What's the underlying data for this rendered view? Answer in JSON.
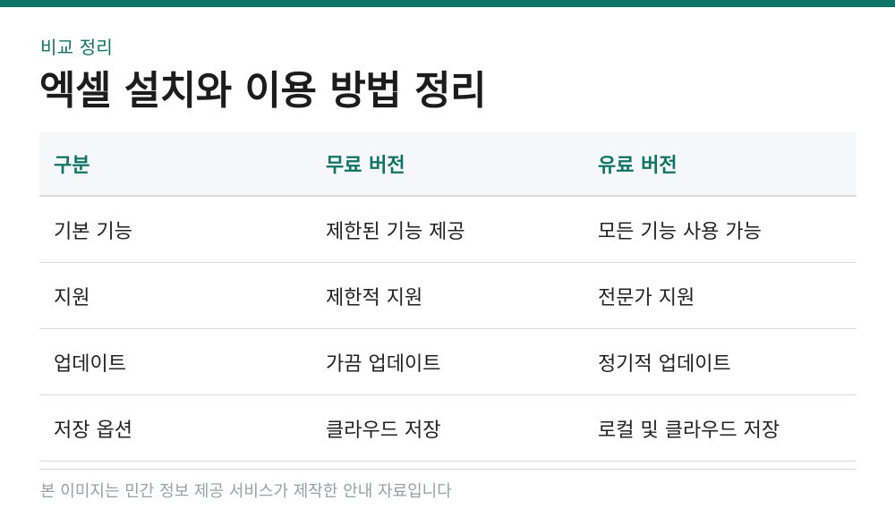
{
  "header": {
    "eyebrow": "비교 정리",
    "title": "엑셀 설치와 이용 방법 정리"
  },
  "table": {
    "columns": [
      "구분",
      "무료 버전",
      "유료 버전"
    ],
    "rows": [
      [
        "기본 기능",
        "제한된 기능 제공",
        "모든 기능 사용 가능"
      ],
      [
        "지원",
        "제한적 지원",
        "전문가 지원"
      ],
      [
        "업데이트",
        "가끔 업데이트",
        "정기적 업데이트"
      ],
      [
        "저장 옵션",
        "클라우드 저장",
        "로컬 및 클라우드 저장"
      ]
    ]
  },
  "footer": {
    "note": "본 이미지는 민간 정보 제공 서비스가 제작한 안내 자료입니다"
  },
  "colors": {
    "accent": "#0f7468",
    "header_bg": "#f6f7f9",
    "divider": "#d9dcdf",
    "muted_text": "#9a9fa4"
  }
}
